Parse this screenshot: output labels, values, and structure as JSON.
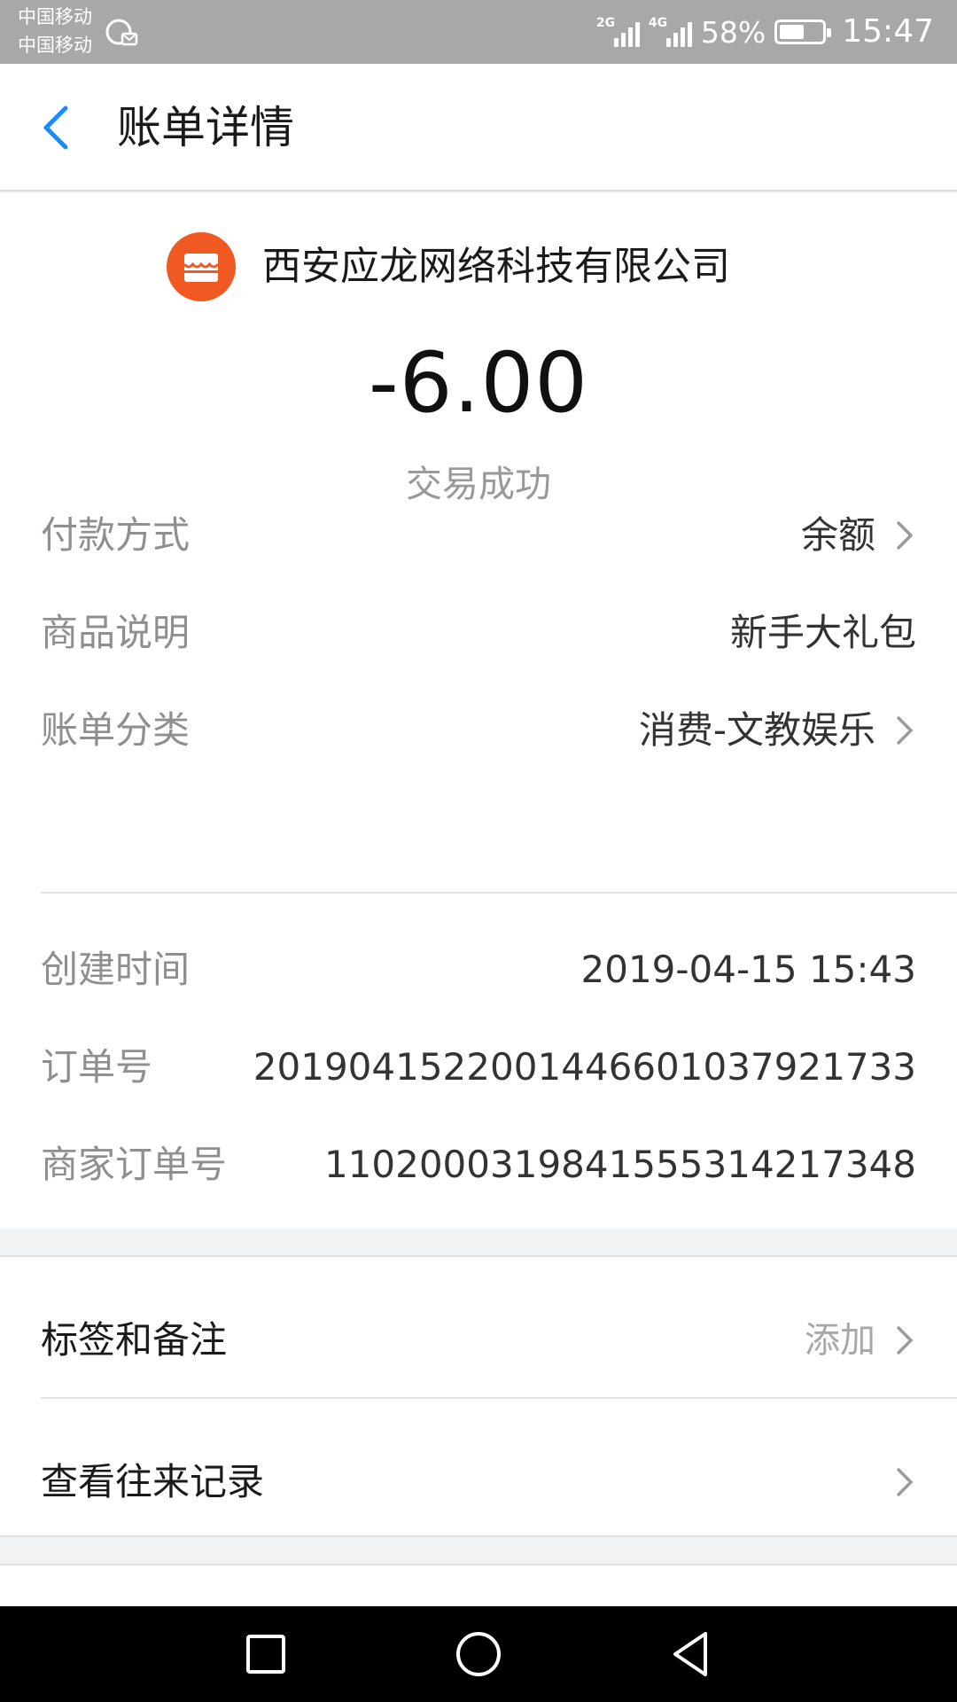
{
  "status_bar": {
    "carrier_1": "中国移动",
    "carrier_2": "中国移动",
    "sim1_network": "2G",
    "sim2_network": "4G",
    "battery_percent": "58%",
    "battery_level": 0.58,
    "time": "15:47"
  },
  "header": {
    "title": "账单详情",
    "back_icon": "chevron-left-icon"
  },
  "merchant": {
    "name": "西安应龙网络科技有限公司",
    "icon": "store-icon",
    "icon_color": "#f05a22"
  },
  "amount": "-6.00",
  "transaction_status": "交易成功",
  "details": [
    {
      "label": "付款方式",
      "value": "余额",
      "has_arrow": true
    },
    {
      "label": "商品说明",
      "value": "新手大礼包",
      "has_arrow": false
    },
    {
      "label": "账单分类",
      "value": "消费-文教娱乐",
      "has_arrow": true
    }
  ],
  "order_info": [
    {
      "label": "创建时间",
      "value": "2019-04-15 15:43"
    },
    {
      "label": "订单号",
      "value": "20190415220014466010379217​33"
    },
    {
      "label": "商家订单号",
      "value": "11020003198415553142173​48"
    }
  ],
  "actions": [
    {
      "label": "标签和备注",
      "value": "添加"
    },
    {
      "label": "查看往来记录",
      "value": ""
    }
  ],
  "colors": {
    "accent": "#1a8cff",
    "status_bar": "#a8a8a8",
    "label_gray": "#8f8f8f"
  }
}
